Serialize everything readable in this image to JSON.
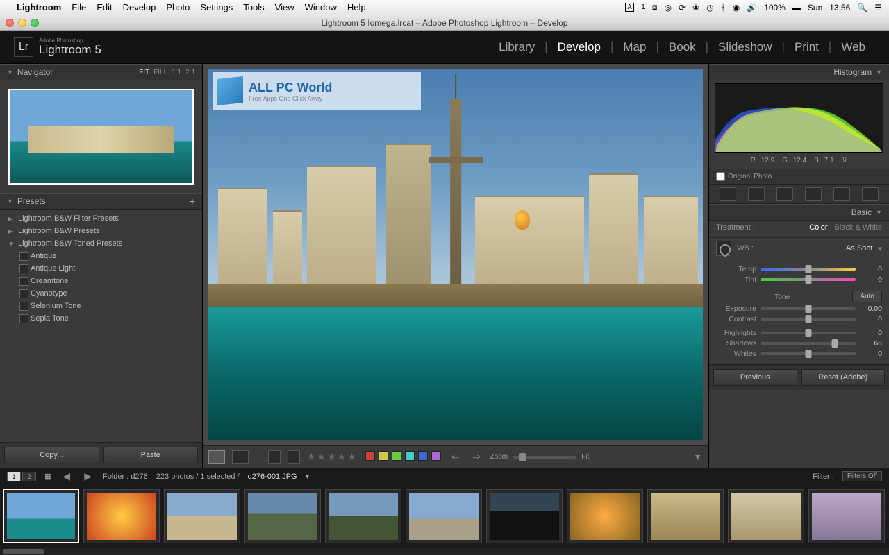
{
  "menubar": {
    "app": "Lightroom",
    "items": [
      "File",
      "Edit",
      "Develop",
      "Photo",
      "Settings",
      "Tools",
      "View",
      "Window",
      "Help"
    ],
    "right": {
      "badge": "1",
      "battery": "100%",
      "day": "Sun",
      "time": "13:56"
    }
  },
  "titlebar": {
    "title": "Lightroom 5 Iomega.lrcat – Adobe Photoshop Lightroom – Develop"
  },
  "logo": {
    "mark": "Lr",
    "small": "Adobe Photoshop",
    "big": "Lightroom 5"
  },
  "modules": [
    "Library",
    "Develop",
    "Map",
    "Book",
    "Slideshow",
    "Print",
    "Web"
  ],
  "activeModule": "Develop",
  "navigator": {
    "title": "Navigator",
    "modes": [
      "FIT",
      "FILL",
      "1:1",
      "2:1"
    ],
    "active": "FIT"
  },
  "presets": {
    "title": "Presets",
    "groups": [
      {
        "label": "Lightroom B&W Filter Presets",
        "open": false
      },
      {
        "label": "Lightroom B&W Presets",
        "open": false
      },
      {
        "label": "Lightroom B&W Toned Presets",
        "open": true,
        "items": [
          "Antique",
          "Antique Light",
          "Creamtone",
          "Cyanotype",
          "Selenium Tone",
          "Sepia Tone"
        ]
      }
    ],
    "copy": "Copy...",
    "paste": "Paste"
  },
  "watermark": {
    "t1": "ALL PC World",
    "t2": "Free Apps One Click Away"
  },
  "toolbar": {
    "zoom": "Zoom",
    "fit": "Fit",
    "colors": [
      "#d44",
      "#7c4",
      "#4ad",
      "#dd4",
      "#6c6",
      "#48c",
      "#a6c"
    ]
  },
  "right": {
    "histogram": "Histogram",
    "rgb": {
      "r": "12.9",
      "g": "12.4",
      "b": "7.1",
      "pct": "%"
    },
    "original": "Original Photo",
    "basic": {
      "title": "Basic",
      "treatment": "Treatment :",
      "color": "Color",
      "bw": "Black & White",
      "wb": "WB :",
      "wbval": "As Shot",
      "temp": "Temp",
      "tint": "Tint",
      "tone": "Tone",
      "auto": "Auto",
      "sliders": [
        {
          "lbl": "Exposure",
          "val": "0.00",
          "pos": 50
        },
        {
          "lbl": "Contrast",
          "val": "0",
          "pos": 50
        },
        {
          "lbl": "Highlights",
          "val": "0",
          "pos": 50
        },
        {
          "lbl": "Shadows",
          "val": "+ 66",
          "pos": 78
        },
        {
          "lbl": "Whites",
          "val": "0",
          "pos": 50
        }
      ]
    },
    "previous": "Previous",
    "reset": "Reset (Adobe)"
  },
  "filmstrip": {
    "pages": [
      "1",
      "2"
    ],
    "folder": "Folder : d276",
    "info": "223 photos / 1 selected /",
    "file": "d276-001.JPG",
    "filter": "Filter :",
    "filterval": "Filters Off"
  }
}
